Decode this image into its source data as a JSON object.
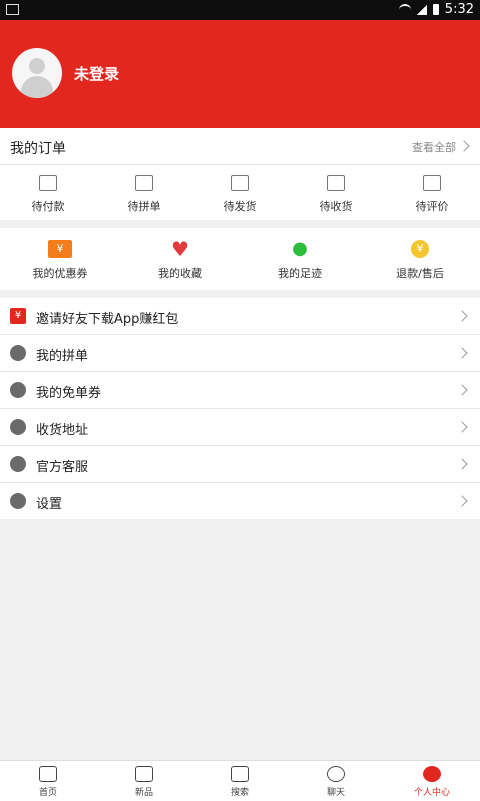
{
  "status": {
    "time": "5:32"
  },
  "header": {
    "login_text": "未登录"
  },
  "orders": {
    "title": "我的订单",
    "view_all": "查看全部",
    "items": [
      {
        "label": "待付款"
      },
      {
        "label": "待拼单"
      },
      {
        "label": "待发货"
      },
      {
        "label": "待收货"
      },
      {
        "label": "待评价"
      }
    ]
  },
  "quick": {
    "items": [
      {
        "label": "我的优惠券",
        "icon": "coupon-icon"
      },
      {
        "label": "我的收藏",
        "icon": "heart-icon"
      },
      {
        "label": "我的足迹",
        "icon": "footprint-icon"
      },
      {
        "label": "退款/售后",
        "icon": "refund-icon"
      }
    ]
  },
  "list": {
    "items": [
      {
        "label": "邀请好友下载App赚红包",
        "icon": "red-envelope-icon"
      },
      {
        "label": "我的拼单",
        "icon": "group-icon"
      },
      {
        "label": "我的免单券",
        "icon": "free-ticket-icon"
      },
      {
        "label": "收货地址",
        "icon": "location-icon"
      },
      {
        "label": "官方客服",
        "icon": "headset-icon"
      },
      {
        "label": "设置",
        "icon": "settings-icon"
      }
    ]
  },
  "tabbar": {
    "tabs": [
      {
        "label": "首页",
        "active": false
      },
      {
        "label": "新品",
        "active": false
      },
      {
        "label": "搜索",
        "active": false
      },
      {
        "label": "聊天",
        "active": false
      },
      {
        "label": "个人中心",
        "active": true
      }
    ]
  },
  "colors": {
    "brand": "#e2271f",
    "coupon": "#f57c1a",
    "favorite": "#e23b3b",
    "footprint": "#2bbd3b",
    "refund": "#f4c62e"
  }
}
